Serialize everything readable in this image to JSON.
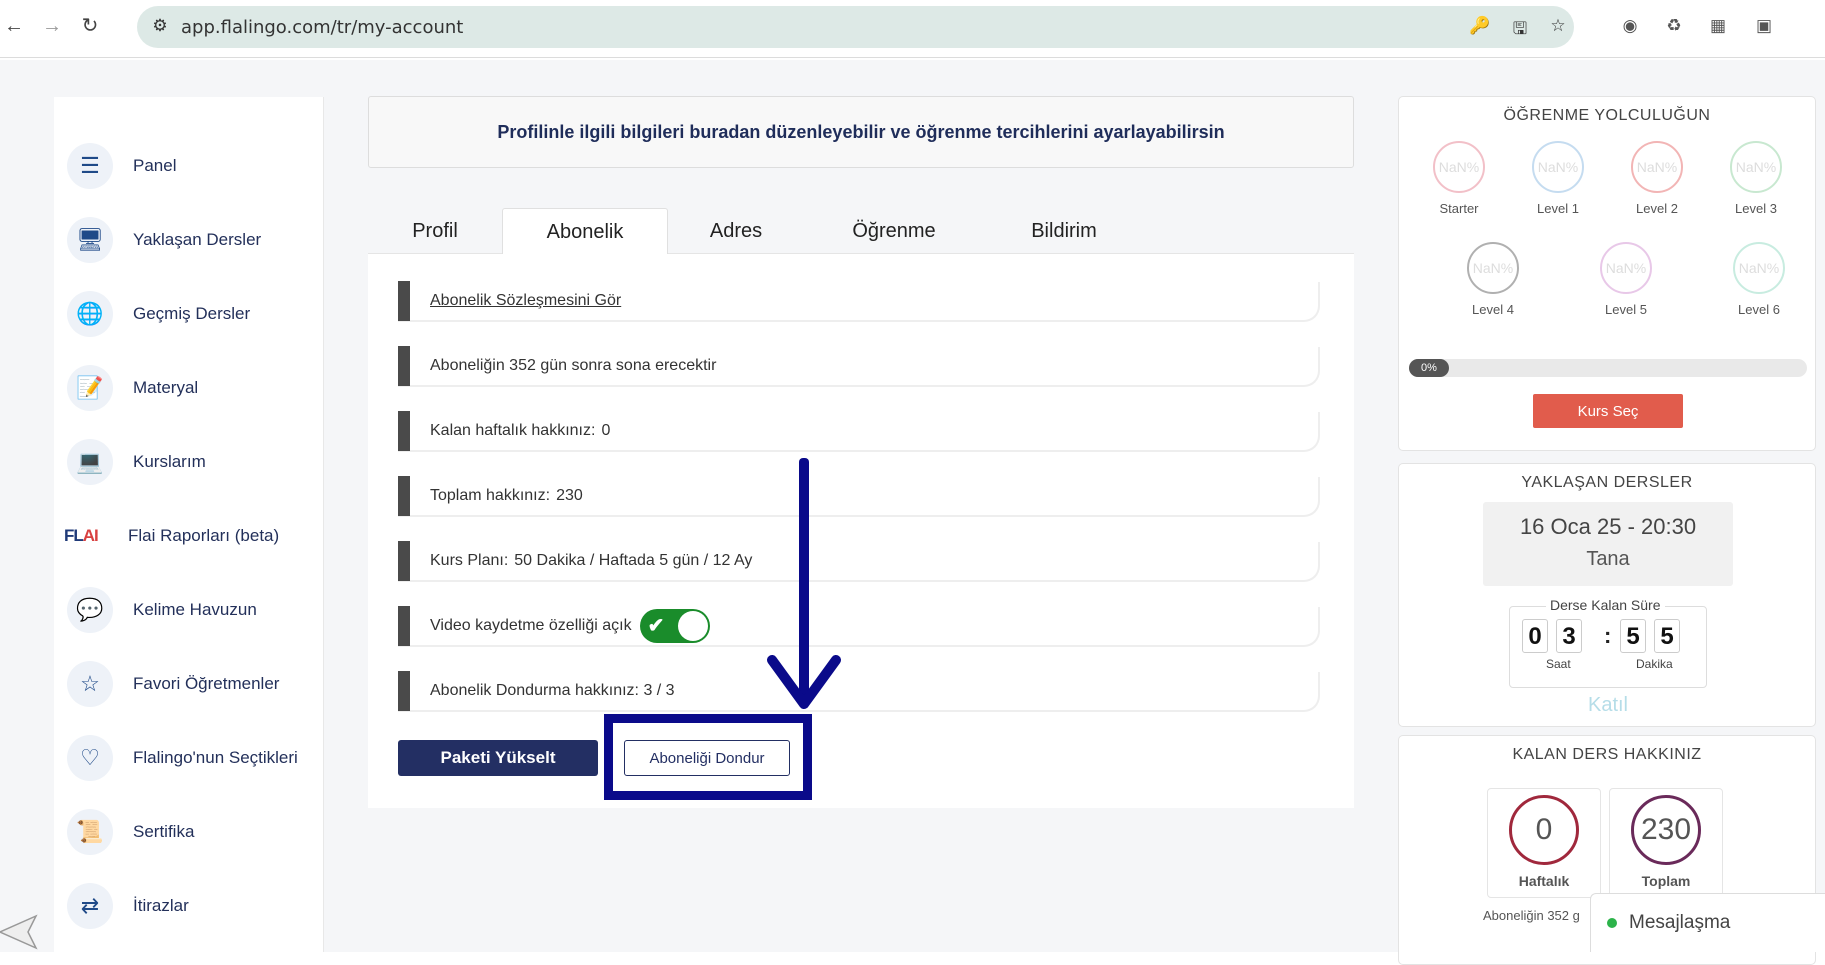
{
  "browser": {
    "url": "app.flalingo.com/tr/my-account",
    "icons": [
      "back-icon",
      "forward-icon",
      "reload-icon",
      "site-info-icon",
      "key-icon",
      "install-icon",
      "star-icon",
      "extension-icons",
      "puzzle-icon"
    ]
  },
  "sidebar": {
    "items": [
      {
        "label": "Panel",
        "icon": "panel-icon"
      },
      {
        "label": "Yaklaşan Dersler",
        "icon": "upcoming-lessons-icon"
      },
      {
        "label": "Geçmiş Dersler",
        "icon": "past-lessons-icon"
      },
      {
        "label": "Materyal",
        "icon": "material-icon"
      },
      {
        "label": "Kurslarım",
        "icon": "courses-icon"
      },
      {
        "label": "Flai Raporları (beta)",
        "icon": "flai-logo",
        "logo_text": "FLAI"
      },
      {
        "label": "Kelime Havuzun",
        "icon": "word-pool-icon"
      },
      {
        "label": "Favori Öğretmenler",
        "icon": "favorite-teachers-icon"
      },
      {
        "label": "Flalingo'nun Seçtikleri",
        "icon": "picks-icon"
      },
      {
        "label": "Sertifika",
        "icon": "certificate-icon"
      },
      {
        "label": "İtirazlar",
        "icon": "objections-icon"
      }
    ]
  },
  "main": {
    "banner": "Profilinle ilgili bilgileri buradan düzenleyebilir ve öğrenme tercihlerini ayarlayabilirsin",
    "tabs": [
      "Profil",
      "Abonelik",
      "Adres",
      "Öğrenme",
      "Bildirim"
    ],
    "active_tab": "Abonelik",
    "rows": {
      "contract_link": "Abonelik Sözleşmesini Gör",
      "expiry": "Aboneliğin 352 gün sonra sona erecektir",
      "weekly_label": "Kalan haftalık hakkınız:",
      "weekly_value": "0",
      "total_label": "Toplam hakkınız:",
      "total_value": "230",
      "plan_label": "Kurs Planı:",
      "plan_value": "50 Dakika / Haftada 5 gün / 12 Ay",
      "video_label": "Video kaydetme özelliği açık",
      "video_enabled": true,
      "freeze_label": "Abonelik Dondurma hakkınız: 3 / 3"
    },
    "upgrade_button": "Paketi Yükselt",
    "freeze_button": "Aboneliği Dondur",
    "annotation_color": "#0a0a8a"
  },
  "journey": {
    "title": "ÖĞRENME YOLCULUĞUN",
    "levels": [
      {
        "name": "Starter",
        "pct": "NaN%",
        "color": "#f2c0c8"
      },
      {
        "name": "Level 1",
        "pct": "NaN%",
        "color": "#c5dcf0"
      },
      {
        "name": "Level 2",
        "pct": "NaN%",
        "color": "#f2b5b5"
      },
      {
        "name": "Level 3",
        "pct": "NaN%",
        "color": "#c8e8d0"
      },
      {
        "name": "Level 4",
        "pct": "NaN%",
        "color": "#b0b0b0"
      },
      {
        "name": "Level 5",
        "pct": "NaN%",
        "color": "#e8c8e8"
      },
      {
        "name": "Level 6",
        "pct": "NaN%",
        "color": "#c8ece0"
      }
    ],
    "progress": "0%",
    "progress_fraction": 0,
    "course_button": "Kurs Seç"
  },
  "upcoming": {
    "title": "YAKLAŞAN DERSLER",
    "datetime": "16 Oca 25 - 20:30",
    "teacher": "Tana",
    "countdown_label": "Derse Kalan Süre",
    "hours": [
      "0",
      "3"
    ],
    "minutes": [
      "5",
      "5"
    ],
    "hours_label": "Saat",
    "minutes_label": "Dakika",
    "join": "Katıl"
  },
  "credits": {
    "title": "KALAN DERS HAKKINIZ",
    "weekly": "0",
    "weekly_label": "Haftalık",
    "weekly_color": "#a0283c",
    "total": "230",
    "total_label": "Toplam",
    "total_color": "#6a2a5a",
    "note": "Aboneliğin 352 g"
  },
  "chat": {
    "label": "Mesajlaşma"
  }
}
